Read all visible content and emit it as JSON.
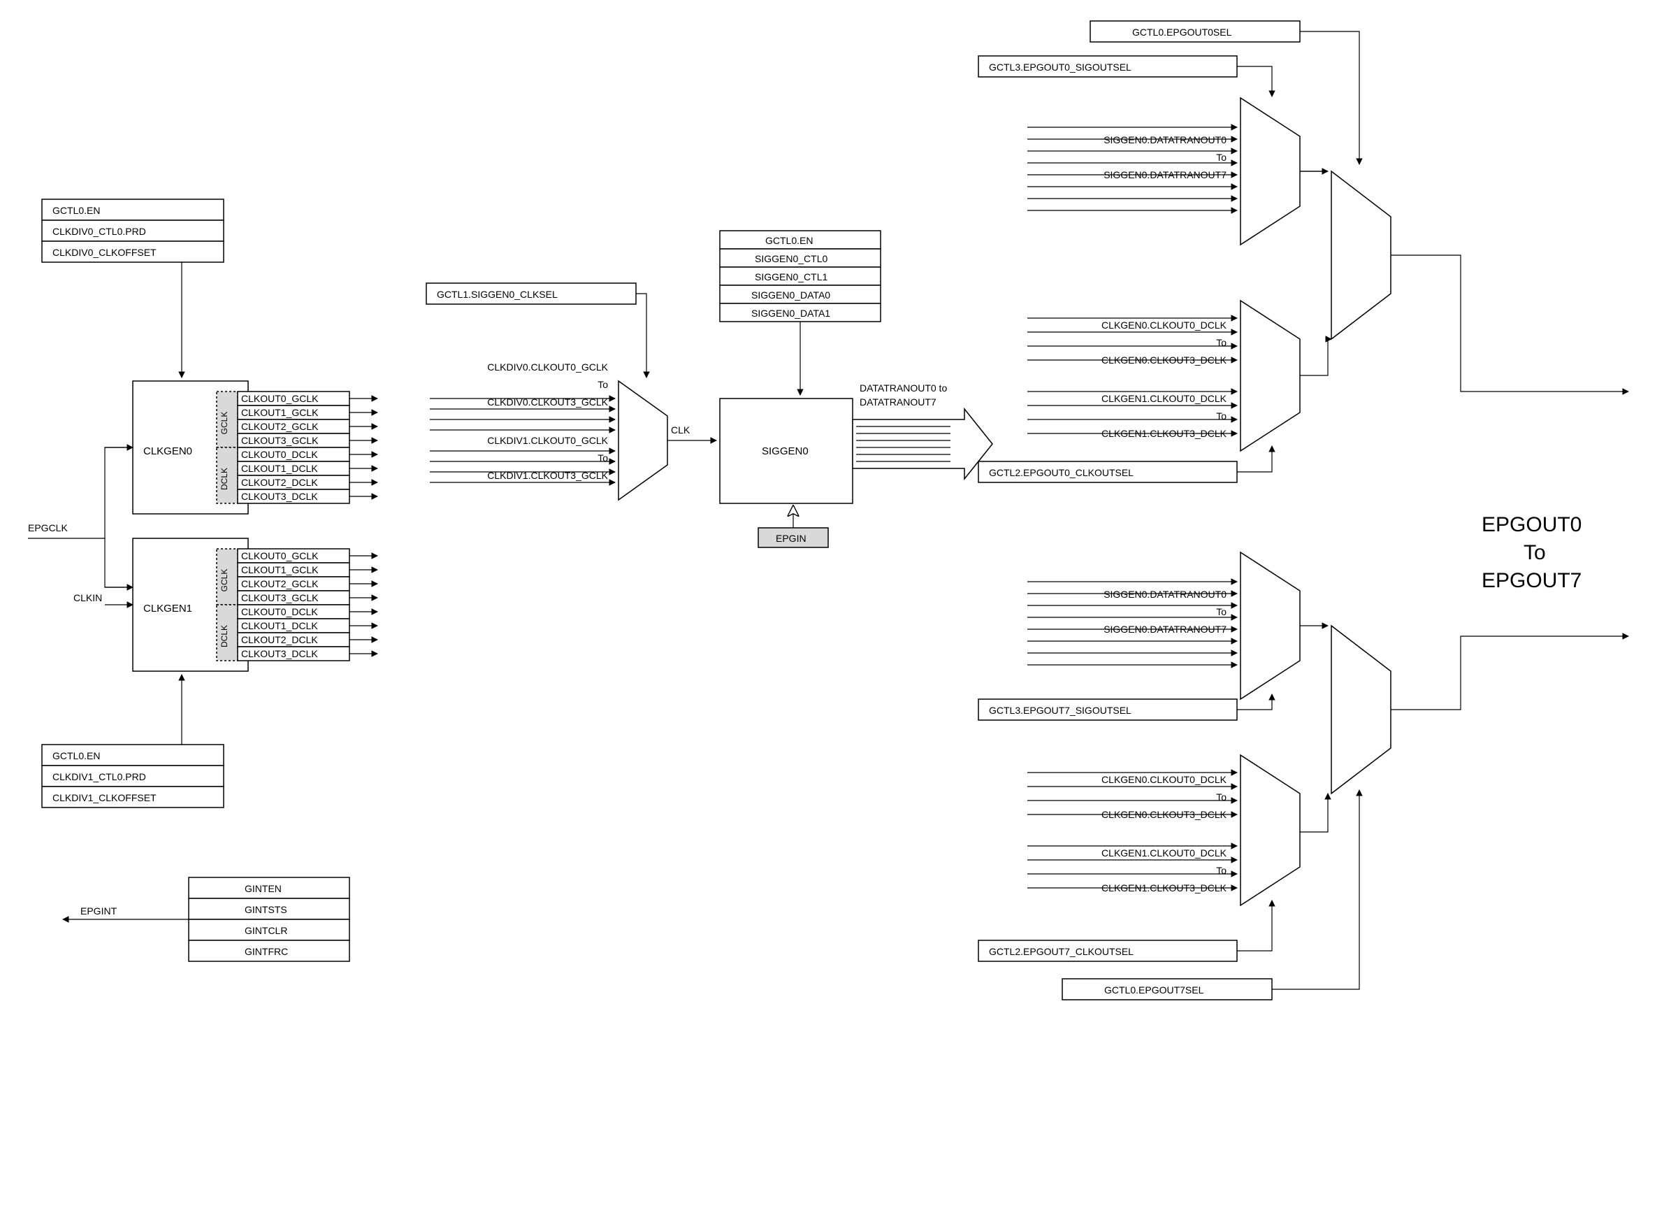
{
  "clkgen0": {
    "name": "CLKGEN0",
    "regs": [
      "GCTL0.EN",
      "CLKDIV0_CTL0.PRD",
      "CLKDIV0_CLKOFFSET"
    ],
    "gclk_label": "GCLK",
    "dclk_label": "DCLK",
    "outs": [
      "CLKOUT0_GCLK",
      "CLKOUT1_GCLK",
      "CLKOUT2_GCLK",
      "CLKOUT3_GCLK",
      "CLKOUT0_DCLK",
      "CLKOUT1_DCLK",
      "CLKOUT2_DCLK",
      "CLKOUT3_DCLK"
    ]
  },
  "clkgen1": {
    "name": "CLKGEN1",
    "regs": [
      "GCTL0.EN",
      "CLKDIV1_CTL0.PRD",
      "CLKDIV1_CLKOFFSET"
    ],
    "gclk_label": "GCLK",
    "dclk_label": "DCLK",
    "outs": [
      "CLKOUT0_GCLK",
      "CLKOUT1_GCLK",
      "CLKOUT2_GCLK",
      "CLKOUT3_GCLK",
      "CLKOUT0_DCLK",
      "CLKOUT1_DCLK",
      "CLKOUT2_DCLK",
      "CLKOUT3_DCLK"
    ]
  },
  "epgclk": "EPGCLK",
  "clkin": "CLKIN",
  "siggen_clksel": "GCTL1.SIGGEN0_CLKSEL",
  "siggen_mux_in": {
    "top1": "CLKDIV0.CLKOUT0_GCLK",
    "top_to": "To",
    "top2": "CLKDIV0.CLKOUT3_GCLK",
    "bot1": "CLKDIV1.CLKOUT0_GCLK",
    "bot_to": "To",
    "bot2": "CLKDIV1.CLKOUT3_GCLK"
  },
  "clk_label": "CLK",
  "siggen": {
    "name": "SIGGEN0",
    "regs": [
      "GCTL0.EN",
      "SIGGEN0_CTL0",
      "SIGGEN0_CTL1",
      "SIGGEN0_DATA0",
      "SIGGEN0_DATA1"
    ],
    "out_label1": "DATATRANOUT0 to",
    "out_label2": "DATATRANOUT7",
    "epgin": "EPGIN"
  },
  "gint": {
    "epgint": "EPGINT",
    "rows": [
      "GINTEN",
      "GINTSTS",
      "GINTCLR",
      "GINTFRC"
    ]
  },
  "mux_sig0_in": {
    "a": "SIGGEN0.DATATRANOUT0",
    "to": "To",
    "b": "SIGGEN0.DATATRANOUT7"
  },
  "mux_clk0_in": {
    "a": "CLKGEN0.CLKOUT0_DCLK",
    "to": "To",
    "b": "CLKGEN0.CLKOUT3_DCLK",
    "c": "CLKGEN1.CLKOUT0_DCLK",
    "to2": "To",
    "d": "CLKGEN1.CLKOUT3_DCLK"
  },
  "mux_sig7_in": {
    "a": "SIGGEN0.DATATRANOUT0",
    "to": "To",
    "b": "SIGGEN0.DATATRANOUT7"
  },
  "mux_clk7_in": {
    "a": "CLKGEN0.CLKOUT0_DCLK",
    "to": "To",
    "b": "CLKGEN0.CLKOUT3_DCLK",
    "c": "CLKGEN1.CLKOUT0_DCLK",
    "to2": "To",
    "d": "CLKGEN1.CLKOUT3_DCLK"
  },
  "sel_labels": {
    "sig0": "GCTL3.EPGOUT0_SIGOUTSEL",
    "clk0": "GCTL2.EPGOUT0_CLKOUTSEL",
    "out0": "GCTL0.EPGOUT0SEL",
    "sig7": "GCTL3.EPGOUT7_SIGOUTSEL",
    "clk7": "GCTL2.EPGOUT7_CLKOUTSEL",
    "out7": "GCTL0.EPGOUT7SEL"
  },
  "epgout": {
    "a": "EPGOUT0",
    "to": "To",
    "b": "EPGOUT7"
  }
}
